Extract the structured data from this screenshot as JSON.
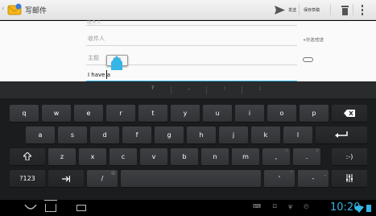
{
  "actionbar": {
    "title": "写邮件",
    "send_label": "发送",
    "save_draft_label": "保存草稿"
  },
  "compose": {
    "ghost_text": "收件人",
    "to_placeholder": "收件人",
    "cc_bcc_label": "+抄送/密送",
    "subject_placeholder": "主题",
    "paste_label": "粘贴",
    "body_text": "I have a"
  },
  "keyboard": {
    "suggestions": [
      "?",
      ",",
      ":",
      ";"
    ],
    "rows": [
      [
        {
          "label": "q"
        },
        {
          "label": "w"
        },
        {
          "label": "e"
        },
        {
          "label": "r"
        },
        {
          "label": "t"
        },
        {
          "label": "y"
        },
        {
          "label": "u"
        },
        {
          "label": "i"
        },
        {
          "label": "o"
        },
        {
          "label": "p"
        }
      ],
      [
        {
          "label": "a"
        },
        {
          "label": "s"
        },
        {
          "label": "d"
        },
        {
          "label": "f"
        },
        {
          "label": "g"
        },
        {
          "label": "h"
        },
        {
          "label": "j"
        },
        {
          "label": "k"
        },
        {
          "label": "l"
        }
      ],
      [
        {
          "label": "z"
        },
        {
          "label": "x"
        },
        {
          "label": "c"
        },
        {
          "label": "v"
        },
        {
          "label": "b"
        },
        {
          "label": "n"
        },
        {
          "label": "m"
        },
        {
          "label": ",",
          "hint": "!"
        },
        {
          "label": ".",
          "hint": "?"
        }
      ],
      [
        {
          "label": "?123"
        },
        {
          "label": "/",
          "hint": "@"
        },
        {
          "label": "'",
          "hint": "\""
        },
        {
          "label": "-",
          "hint": "_"
        }
      ]
    ],
    "backspace_icon": "backspace-icon",
    "enter_icon": "enter-icon",
    "shift_icon": "shift-icon",
    "tab_icon": "tab-icon",
    "smiley_label": ":-)",
    "settings_icon": "keyboard-settings-icon"
  },
  "statusbar": {
    "time": "10:20"
  }
}
